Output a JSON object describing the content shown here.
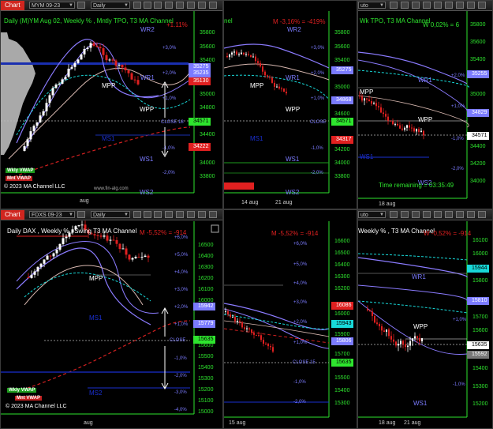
{
  "top_left": {
    "toolbar": {
      "chart_tab": "Chart",
      "symbol": "MYM 09-23",
      "period": "Daily"
    },
    "title": "Daily (M)YM  Aug 02, Weekly % , Mntly TPO, T3 MA Channel",
    "stats": "+1.11%",
    "levels": [
      "WR2",
      "WR1",
      "MPP",
      "WPP",
      "MS1",
      "WS1",
      "WS2"
    ],
    "close_label": "CLOSE 18",
    "axis": [
      "35800",
      "35600",
      "35400",
      "35200",
      "35000",
      "34800",
      "34600",
      "34400",
      "34200",
      "34000",
      "33800"
    ],
    "pct": [
      "+3,0%",
      "+2,0%",
      "+1,0%",
      "-1,0%",
      "-2,0%"
    ],
    "tags": [
      "35275",
      "35235",
      "35130",
      "34571",
      "34222"
    ],
    "legend": [
      "Wkly VWAP",
      "Mnt VWAP"
    ],
    "copyright": "© 2023 MA Channel LLC",
    "website": "www.fin-alg.com",
    "date": "aug"
  },
  "top_mid": {
    "title": "nel",
    "stats": "M -3,16% = -419%",
    "levels": [
      "WR2",
      "WR1",
      "MPP",
      "WPP",
      "MS1",
      "WS1",
      "WS2"
    ],
    "close_label": "CLOSE",
    "axis": [
      "35800",
      "35600",
      "35400",
      "35200",
      "35000",
      "34800",
      "34600",
      "34400",
      "34200",
      "34000",
      "33800"
    ],
    "pct": [
      "+3,0%",
      "+2,0%",
      "+1,0%",
      "-1,0%",
      "-2,0%"
    ],
    "tags": [
      "35275",
      "34868",
      "34571",
      "34317"
    ],
    "dates": [
      "14 aug",
      "21 aug"
    ]
  },
  "top_right": {
    "toolbar": {
      "selector": "uto"
    },
    "title": "Wk TPO, T3 MA Channel",
    "stats": "W 0,02% = 6",
    "levels": [
      "WR1",
      "MPP",
      "WPP",
      "WS1",
      "WS2"
    ],
    "axis": [
      "35800",
      "35600",
      "35400",
      "35200",
      "35000",
      "34800",
      "34600",
      "34400",
      "34200",
      "34000",
      "33800"
    ],
    "pct": [
      "+2,0%",
      "+1,0%",
      "-1,0%",
      "-2,0%"
    ],
    "tags": [
      "35255",
      "34829",
      "34571"
    ],
    "timer": "Time remaining = 03:35:49",
    "date": "18 aug"
  },
  "bottom_left": {
    "toolbar": {
      "chart_tab": "Chart",
      "symbol": "FDXS 09-23",
      "period": "Daily"
    },
    "title": "Daily DAX , Weekly % , Swing T3 MA Channel",
    "stats": "M -5,52% = -914",
    "levels": [
      "MPP",
      "MS1",
      "MS2"
    ],
    "close_label": "CLOSE",
    "axis": [
      "16500",
      "16400",
      "16300",
      "16200",
      "16100",
      "16000",
      "15900",
      "15800",
      "15700",
      "15600",
      "15500",
      "15400",
      "15300",
      "15200",
      "15100",
      "15000"
    ],
    "pct": [
      "+6,0%",
      "+5,0%",
      "+4,0%",
      "+3,0%",
      "+2,0%",
      "+1,0%",
      "-1,0%",
      "-2,0%",
      "-3,0%",
      "-4,0%"
    ],
    "tags": [
      "15942",
      "15779",
      "15635"
    ],
    "legend": [
      "Wkly VWAP",
      "Mnt VWAP"
    ],
    "copyright": "© 2023 MA Channel LLC",
    "date": "aug"
  },
  "bottom_mid": {
    "stats": "M -5,52% = -914",
    "close_label": "CLOSE 15",
    "axis": [
      "16600",
      "16500",
      "16400",
      "16300",
      "16200",
      "16100",
      "16000",
      "15900",
      "15800",
      "15700",
      "15600",
      "15500",
      "15400",
      "15300"
    ],
    "pct": [
      "+6,0%",
      "+5,0%",
      "+4,0%",
      "+3,0%",
      "+2,0%",
      "+1,0%",
      "-1,0%",
      "-2,0%"
    ],
    "tags": [
      "16086",
      "15943",
      "15806",
      "15635"
    ],
    "date": "15 aug"
  },
  "bottom_right": {
    "toolbar": {
      "selector": "uto"
    },
    "title": "Weekly % , T3 MA Channel",
    "stats": "W -0,52% = -914",
    "levels": [
      "WR1",
      "WPP",
      "WS1"
    ],
    "axis": [
      "16100",
      "16000",
      "15900",
      "15800",
      "15700",
      "15600",
      "15500",
      "15400",
      "15300",
      "15200"
    ],
    "pct": [
      "+1,0%",
      "-1,0%"
    ],
    "tags": [
      "15944",
      "15810",
      "15635",
      "15592"
    ],
    "dates": [
      "18 aug",
      "21 aug"
    ]
  },
  "colors": {
    "up": "#ffffff",
    "down": "#e02020",
    "axis": "#2ee52e",
    "level": "#7b7bff",
    "cyan": "#18d8d8"
  }
}
